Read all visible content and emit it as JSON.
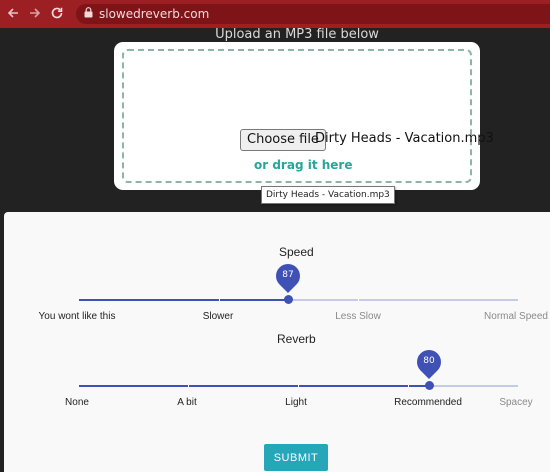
{
  "browser": {
    "url": "slowedreverb.com"
  },
  "upload": {
    "title": "Upload an MP3 file below",
    "choose_file_label": "Choose file",
    "file_name": "Dirty Heads - Vacation.mp3",
    "drag_text": "or drag it here",
    "tooltip": "Dirty Heads - Vacation.mp3"
  },
  "speed": {
    "label": "Speed",
    "value": 87,
    "value_label": "87",
    "marks": [
      "You wont like this",
      "Slower",
      "Less Slow",
      "Normal Speed"
    ]
  },
  "reverb": {
    "label": "Reverb",
    "value": 80,
    "value_label": "80",
    "marks": [
      "None",
      "A bit",
      "Light",
      "Recommended",
      "Spacey"
    ]
  },
  "submit_label": "SUBMIT",
  "colors": {
    "browser_bar": "#9c1f23",
    "slider": "#3f51b5",
    "submit": "#26a6b9",
    "drag_text": "#26a69a"
  }
}
